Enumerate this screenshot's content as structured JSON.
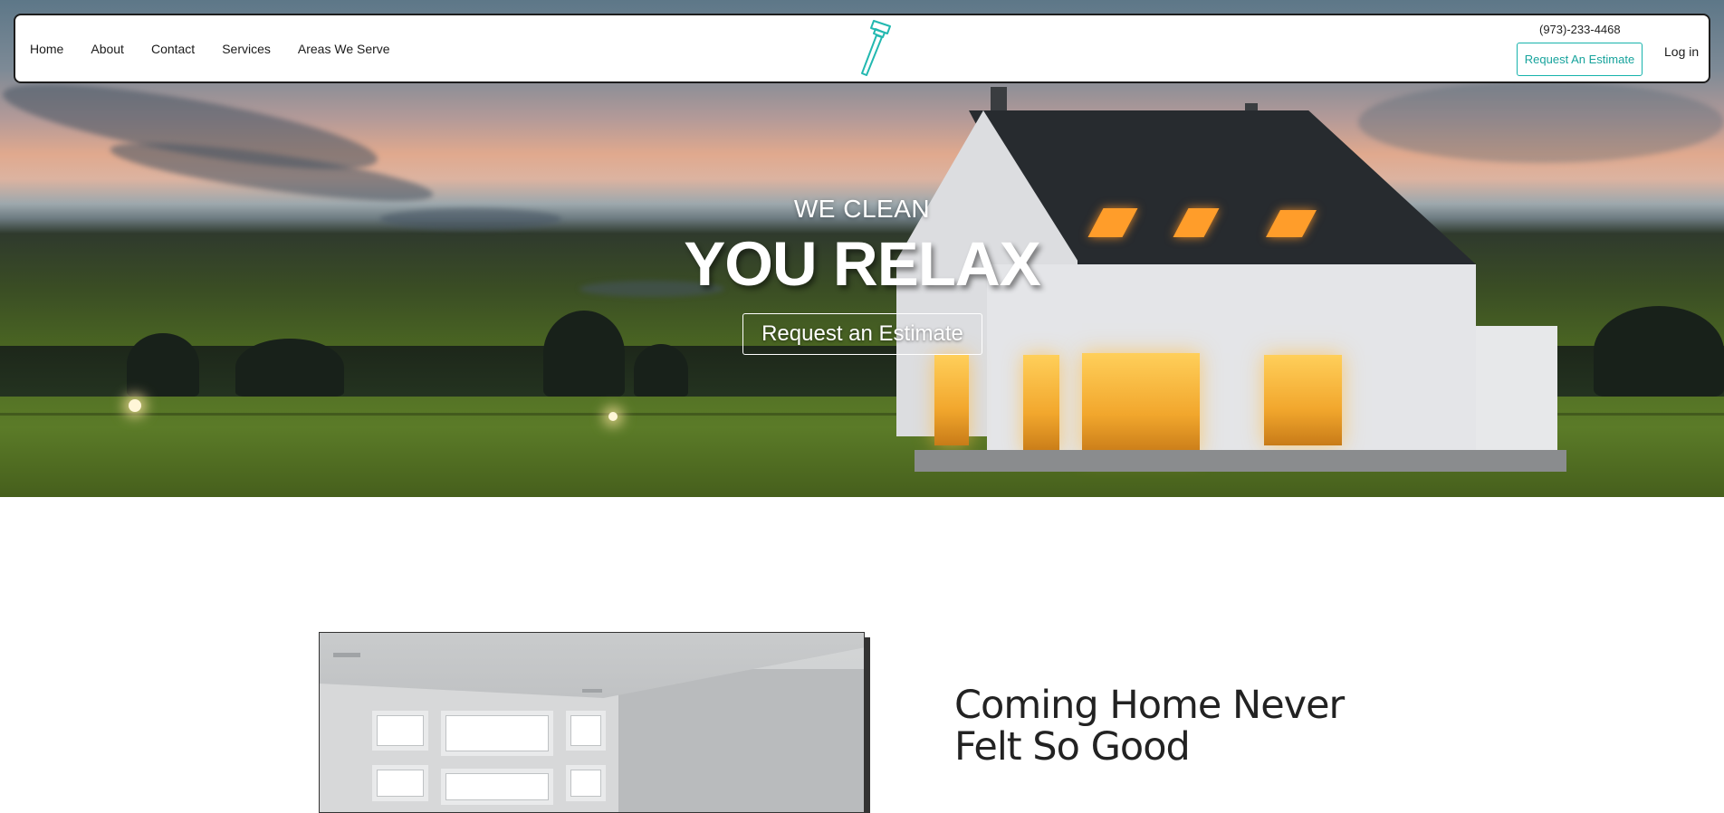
{
  "nav": {
    "links": [
      "Home",
      "About",
      "Contact",
      "Services",
      "Areas We Serve"
    ],
    "phone": "(973)-233-4468",
    "estimate_button": "Request An Estimate",
    "login": "Log in",
    "logo_icon": "squeegee-icon"
  },
  "hero": {
    "subtitle": "WE CLEAN",
    "title": "YOU RELAX",
    "cta_button": "Request an Estimate",
    "image": "modern-house-dusk-photo"
  },
  "intro": {
    "headline": "Coming Home Never Felt So Good",
    "image": "clean-living-room-photo"
  },
  "colors": {
    "accent": "#17b3ac",
    "nav_border": "#1d1d1d",
    "text": "#222222"
  }
}
